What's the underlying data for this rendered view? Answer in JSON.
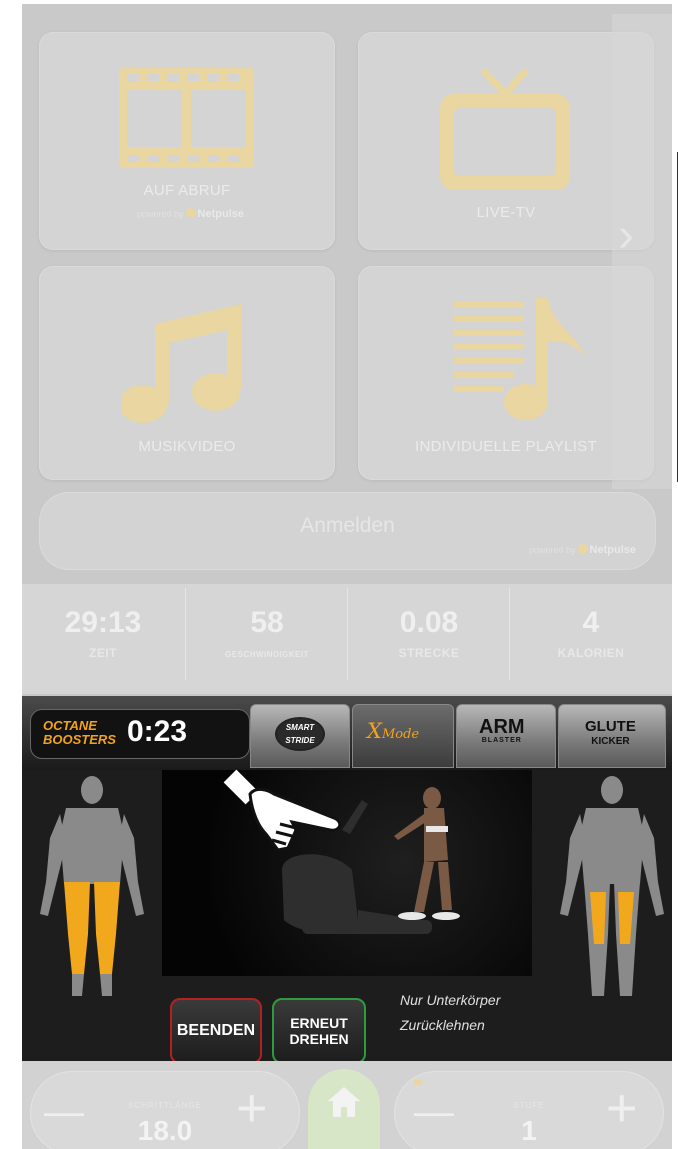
{
  "media_tiles": [
    {
      "label": "AUF ABRUF",
      "icon": "film-icon",
      "powered_prefix": "powered by",
      "powered_brand": "Netpulse"
    },
    {
      "label": "LIVE-TV",
      "icon": "tv-icon"
    },
    {
      "label": "MUSIKVIDEO",
      "icon": "music-note-icon"
    },
    {
      "label": "INDIVIDUELLE PLAYLIST",
      "icon": "playlist-icon"
    }
  ],
  "next_arrow": "›",
  "login": {
    "label": "Anmelden",
    "powered_prefix": "powered by",
    "powered_brand": "Netpulse"
  },
  "stats": [
    {
      "value": "29:13",
      "label": "ZEIT"
    },
    {
      "value": "58",
      "label": "GESCHWINDIGKEIT"
    },
    {
      "value": "0.08",
      "label": "STRECKE"
    },
    {
      "value": "4",
      "label": "KALORIEN"
    }
  ],
  "boosters": {
    "title_line1": "OCTANE",
    "title_line2": "BOOSTERS",
    "timer": "0:23",
    "tabs": [
      {
        "line1": "SMART",
        "line2": "STRIDE"
      },
      {
        "line1": "X",
        "line2": "Mode"
      },
      {
        "line1": "ARM",
        "line2": "BLASTER"
      },
      {
        "line1": "GLUTE",
        "line2": "KICKER"
      }
    ],
    "active_tab": "X Mode",
    "end_button": "BEENDEN",
    "turn_button_line1": "ERNEUT",
    "turn_button_line2": "DREHEN",
    "instruction_line1": "Nur Unterkörper",
    "instruction_line2": "Zurücklehnen"
  },
  "controls": {
    "stride": {
      "label": "SCHRITTLÄNGE",
      "value": "18.0",
      "minus": "—",
      "plus": "+"
    },
    "level": {
      "label": "STUFE",
      "value": "1",
      "minus": "—",
      "plus": "+"
    }
  },
  "colors": {
    "accent_orange": "#f3a31a",
    "muscle_yellow": "#f2a81c",
    "tile_icon": "#ead6a0"
  }
}
